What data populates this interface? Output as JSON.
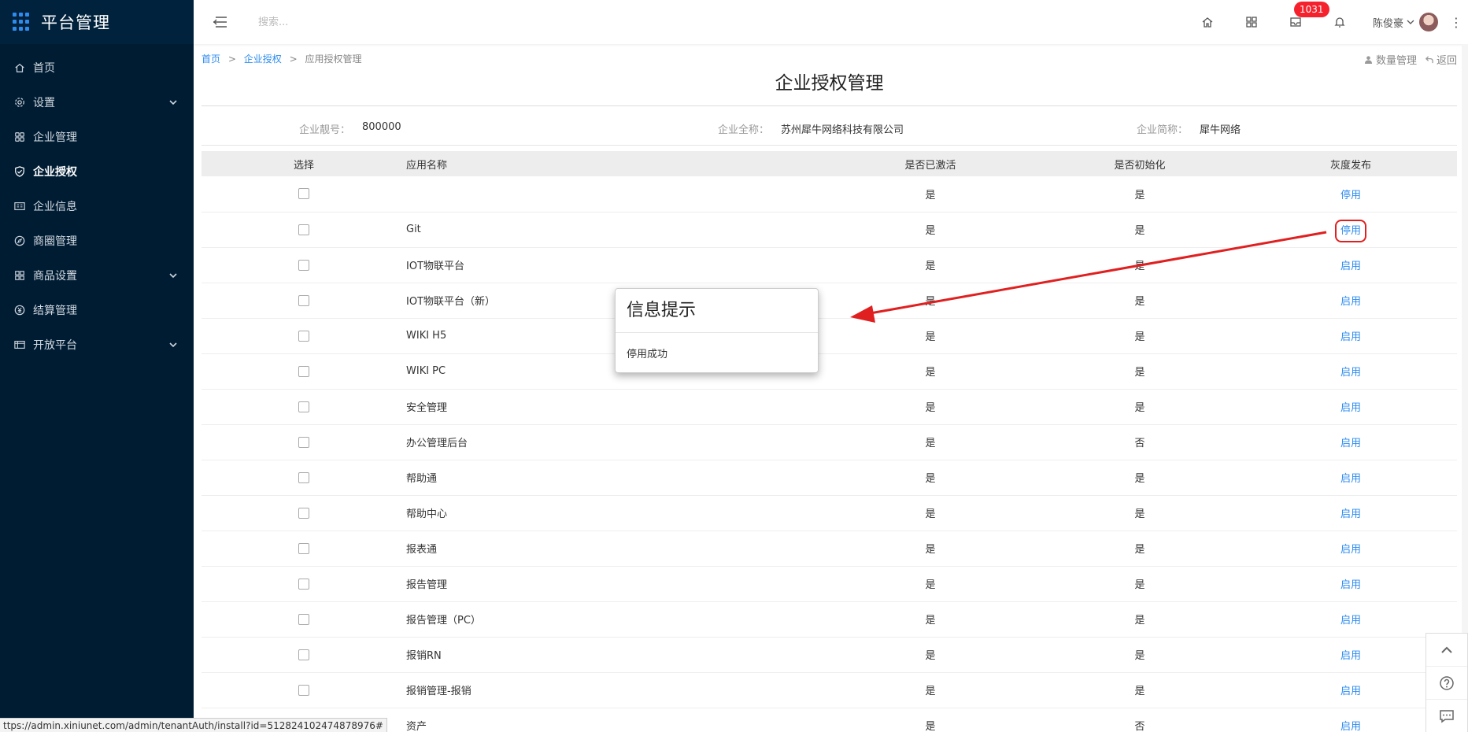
{
  "app": {
    "title": "平台管理"
  },
  "sidebar": {
    "items": [
      {
        "label": "首页",
        "icon": "home-icon"
      },
      {
        "label": "设置",
        "icon": "gear-icon",
        "expandable": true
      },
      {
        "label": "企业管理",
        "icon": "apps-icon"
      },
      {
        "label": "企业授权",
        "icon": "shield-check-icon",
        "active": true
      },
      {
        "label": "企业信息",
        "icon": "id-card-icon"
      },
      {
        "label": "商圈管理",
        "icon": "compass-icon"
      },
      {
        "label": "商品设置",
        "icon": "grid-icon",
        "expandable": true
      },
      {
        "label": "结算管理",
        "icon": "yen-icon"
      },
      {
        "label": "开放平台",
        "icon": "table-icon",
        "expandable": true
      }
    ]
  },
  "topbar": {
    "search_placeholder": "搜索...",
    "badge_count": "1031",
    "user_name": "陈俊豪",
    "more": "⋮"
  },
  "breadcrumb": {
    "home": "首页",
    "parent": "企业授权",
    "current": "应用授权管理",
    "sep": ">"
  },
  "right_links": {
    "quantity": "数量管理",
    "back": "返回"
  },
  "page": {
    "title": "企业授权管理"
  },
  "info": {
    "code_label": "企业靓号：",
    "code_value": "800000",
    "fullname_label": "企业全称：",
    "fullname_value": "苏州犀牛网络科技有限公司",
    "shortname_label": "企业简称：",
    "shortname_value": "犀牛网络"
  },
  "table": {
    "headers": {
      "select": "选择",
      "name": "应用名称",
      "activated": "是否已激活",
      "initialized": "是否初始化",
      "gray": "灰度发布"
    },
    "rows": [
      {
        "name": "",
        "activated": "是",
        "initialized": "是",
        "gray": "停用"
      },
      {
        "name": "Git",
        "activated": "是",
        "initialized": "是",
        "gray": "停用"
      },
      {
        "name": "IOT物联平台",
        "activated": "是",
        "initialized": "是",
        "gray": "启用"
      },
      {
        "name": "IOT物联平台（新）",
        "activated": "是",
        "initialized": "是",
        "gray": "启用"
      },
      {
        "name": "WIKI H5",
        "activated": "是",
        "initialized": "是",
        "gray": "启用"
      },
      {
        "name": "WIKI PC",
        "activated": "是",
        "initialized": "是",
        "gray": "启用"
      },
      {
        "name": "安全管理",
        "activated": "是",
        "initialized": "是",
        "gray": "启用"
      },
      {
        "name": "办公管理后台",
        "activated": "是",
        "initialized": "否",
        "gray": "启用"
      },
      {
        "name": "帮助通",
        "activated": "是",
        "initialized": "是",
        "gray": "启用"
      },
      {
        "name": "帮助中心",
        "activated": "是",
        "initialized": "是",
        "gray": "启用"
      },
      {
        "name": "报表通",
        "activated": "是",
        "initialized": "是",
        "gray": "启用"
      },
      {
        "name": "报告管理",
        "activated": "是",
        "initialized": "是",
        "gray": "启用"
      },
      {
        "name": "报告管理（PC）",
        "activated": "是",
        "initialized": "是",
        "gray": "启用"
      },
      {
        "name": "报销RN",
        "activated": "是",
        "initialized": "是",
        "gray": "启用"
      },
      {
        "name": "报销管理-报销",
        "activated": "是",
        "initialized": "是",
        "gray": "启用"
      },
      {
        "name": "资产",
        "activated": "是",
        "initialized": "否",
        "gray": "启用"
      }
    ]
  },
  "modal": {
    "title": "信息提示",
    "message": "停用成功"
  },
  "status_url": "ttps://admin.xiniunet.com/admin/tenantAuth/install?id=512824102474878976#",
  "colors": {
    "sidebar_bg": "#001c33",
    "link": "#2d8cf0",
    "badge": "#f5222d",
    "annotation": "#e02020"
  }
}
